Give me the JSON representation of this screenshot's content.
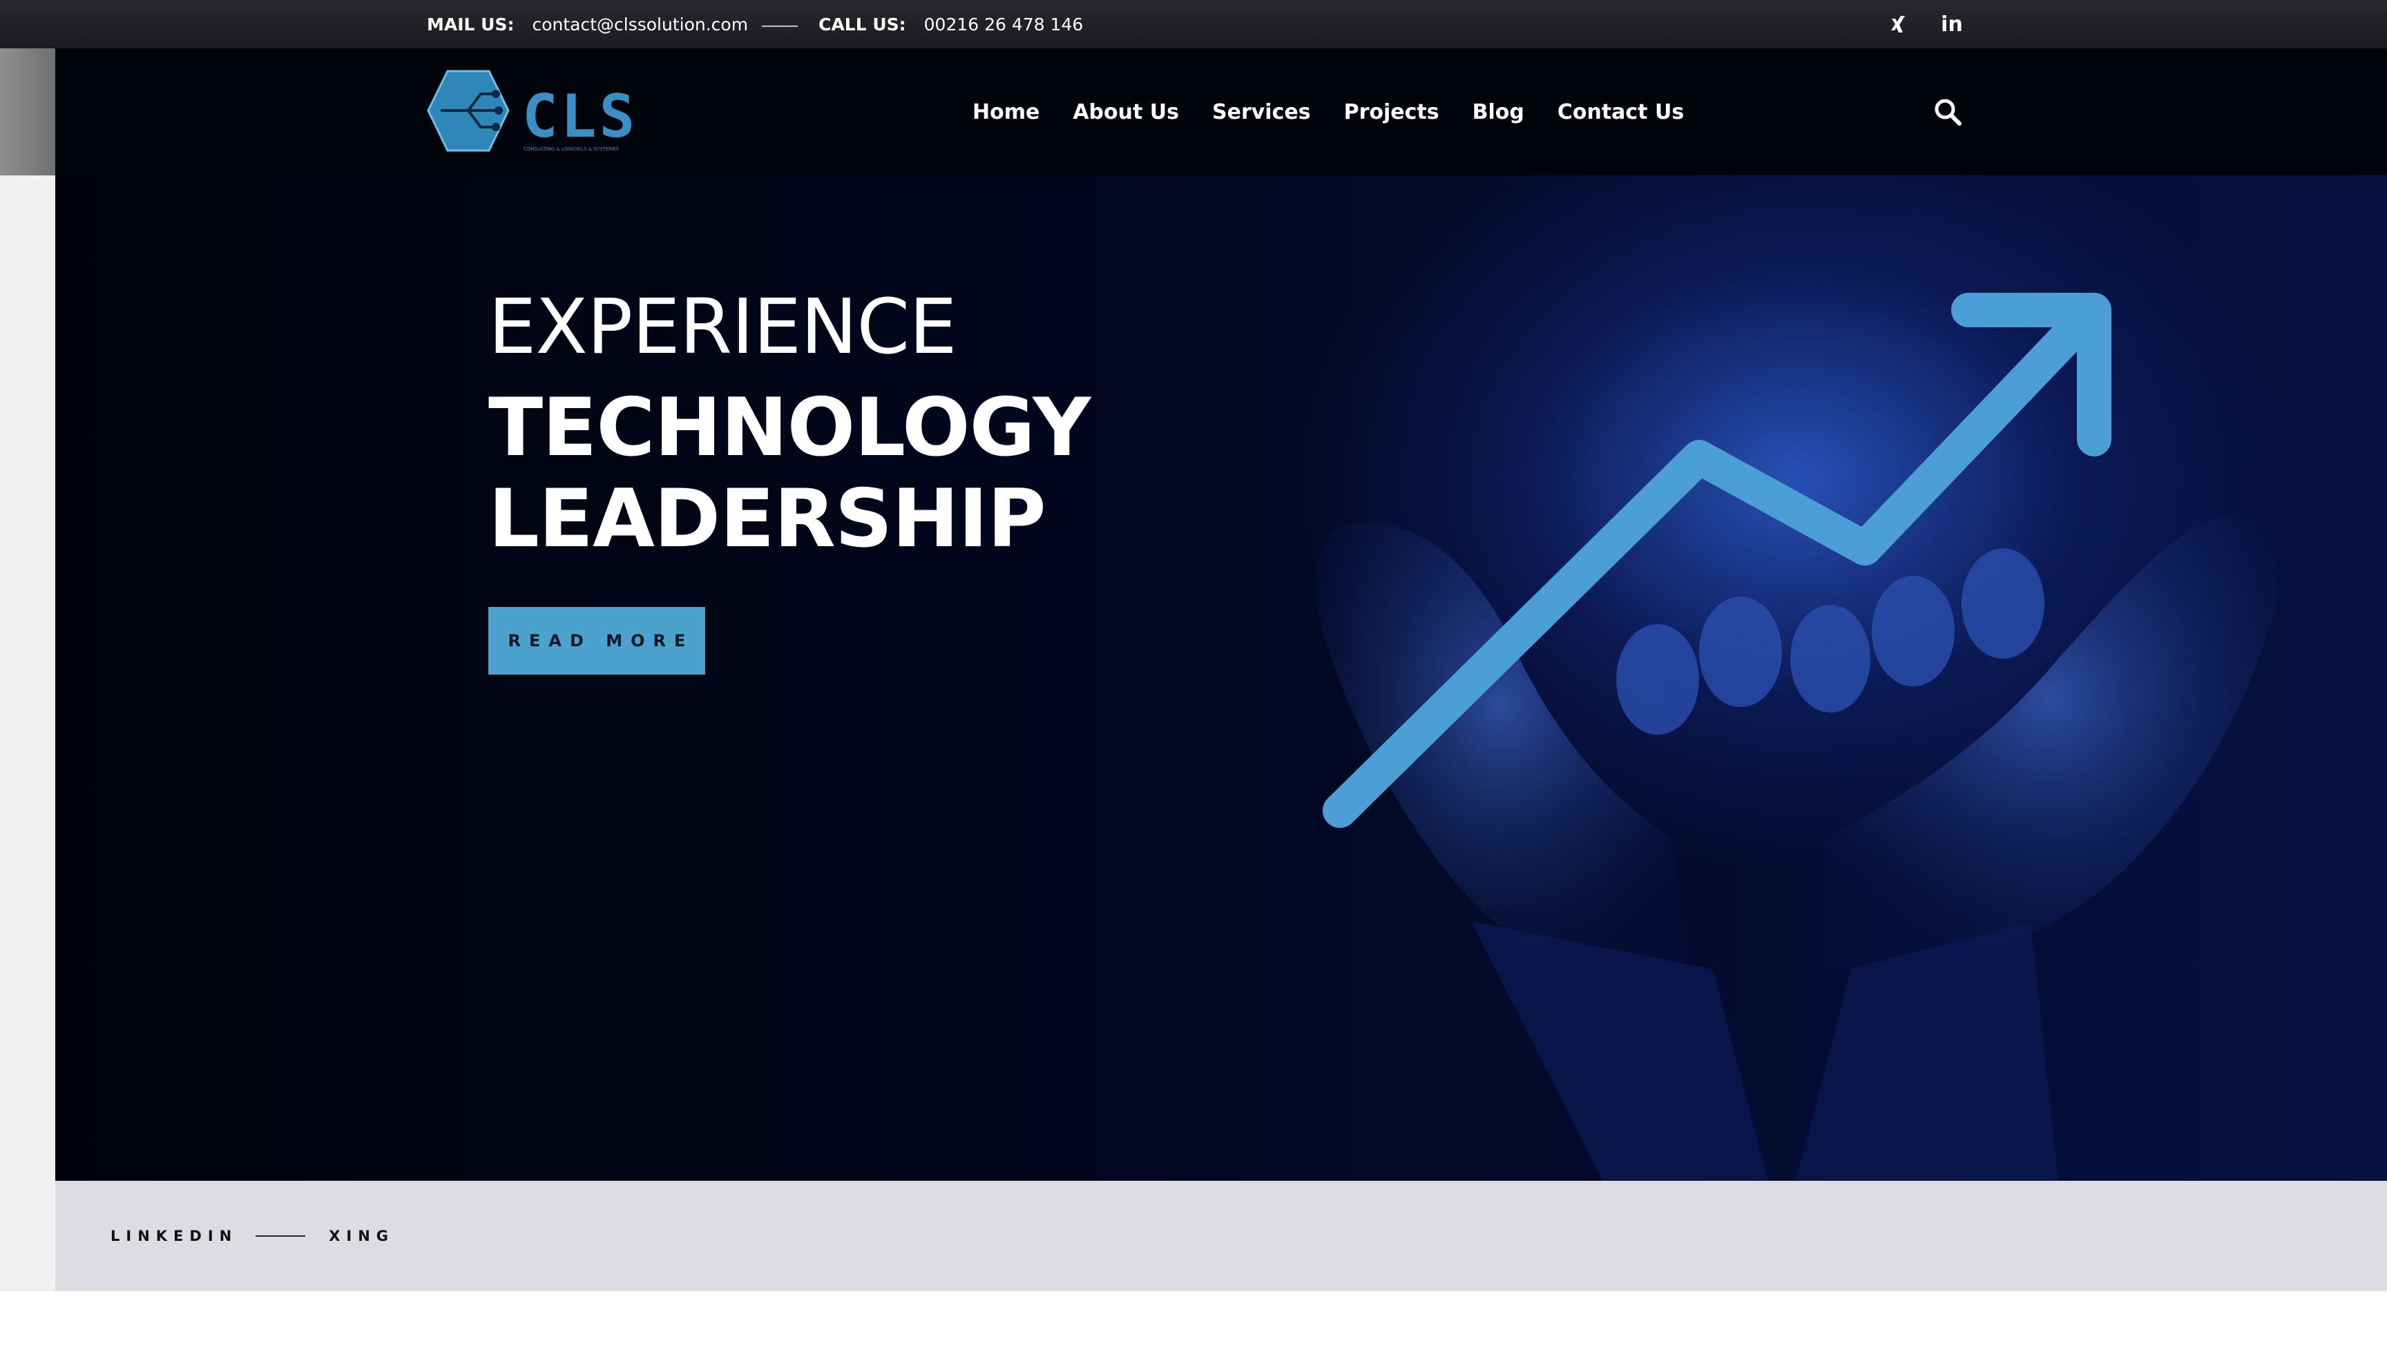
{
  "topbar": {
    "mail_label": "MAIL US:",
    "mail_value": "contact@clssolution.com",
    "call_label": "CALL US:",
    "call_value": "00216 26 478 146",
    "social": [
      {
        "icon": "xing-icon",
        "glyph": "✗"
      },
      {
        "icon": "linkedin-icon",
        "glyph": "in"
      }
    ]
  },
  "header": {
    "logo_text": "CLS",
    "logo_tagline": "CONSULTING & LOGICIELS & SYSTEMES",
    "nav": [
      "Home",
      "About Us",
      "Services",
      "Projects",
      "Blog",
      "Contact Us"
    ],
    "search_icon": "search-icon"
  },
  "hero": {
    "line1": "EXPERIENCE",
    "line2": "TECHNOLOGY",
    "line3": "LEADERSHIP",
    "button": "READ MORE",
    "illustration": "hands-holding-growth-arrow"
  },
  "footer_social": {
    "linkedin": "LINKEDIN",
    "xing": "XING"
  },
  "colors": {
    "accent": "#4ba2cc",
    "header_bg": "#02040c",
    "topbar_bg": "#1f2025",
    "hero_glow": "#2d5ccd",
    "strip_bg": "#dcdde0"
  }
}
